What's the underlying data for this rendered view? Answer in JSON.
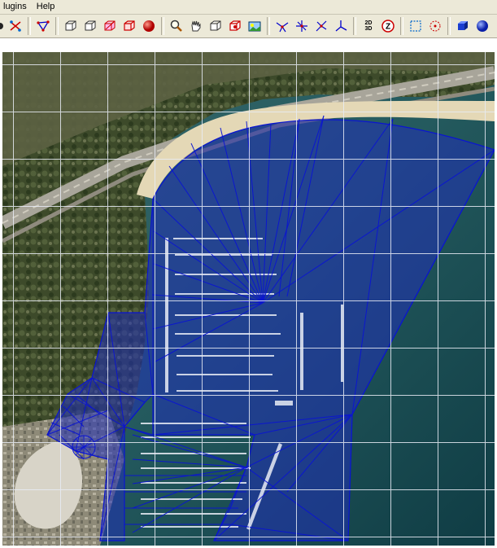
{
  "menubar": {
    "items": [
      {
        "label": "lugins"
      },
      {
        "label": "Help"
      }
    ]
  },
  "toolbar": {
    "buttons": [
      {
        "icon": "partial-icon"
      },
      {
        "icon": "scissors-nodes-icon"
      },
      {
        "icon": "node-tool-icon"
      },
      {
        "icon": "wire-cube-icon"
      },
      {
        "icon": "wire-cube-icon"
      },
      {
        "icon": "red-cube-icon"
      },
      {
        "icon": "red-cube-outline-icon"
      },
      {
        "icon": "red-sphere-icon"
      },
      {
        "icon": "zoom-icon"
      },
      {
        "icon": "hand-pan-icon"
      },
      {
        "icon": "cube-view-icon"
      },
      {
        "icon": "cube-red-icon"
      },
      {
        "icon": "image-view-icon"
      },
      {
        "icon": "mesh-node-icon"
      },
      {
        "icon": "mesh-node-icon"
      },
      {
        "icon": "mesh-node-icon"
      },
      {
        "icon": "axes-icon"
      },
      {
        "icon": "2d-3d-toggle-icon"
      },
      {
        "icon": "z-scale-icon"
      },
      {
        "icon": "select-box-icon"
      },
      {
        "icon": "target-icon"
      },
      {
        "icon": "blue-cube-icon"
      },
      {
        "icon": "blue-sphere-icon"
      },
      {
        "icon": "blue-cylinder-icon"
      },
      {
        "icon": "blue-cylinder-icon"
      }
    ],
    "two_d_label": "2D",
    "three_d_label": "3D",
    "z_label": "Z"
  },
  "colors": {
    "mesh_line": "#0a14d2",
    "mesh_fill": "#2030b8",
    "grid_line": "#e8ecf5",
    "sea": "#1c4c50",
    "beach": "#e4d8b6"
  }
}
